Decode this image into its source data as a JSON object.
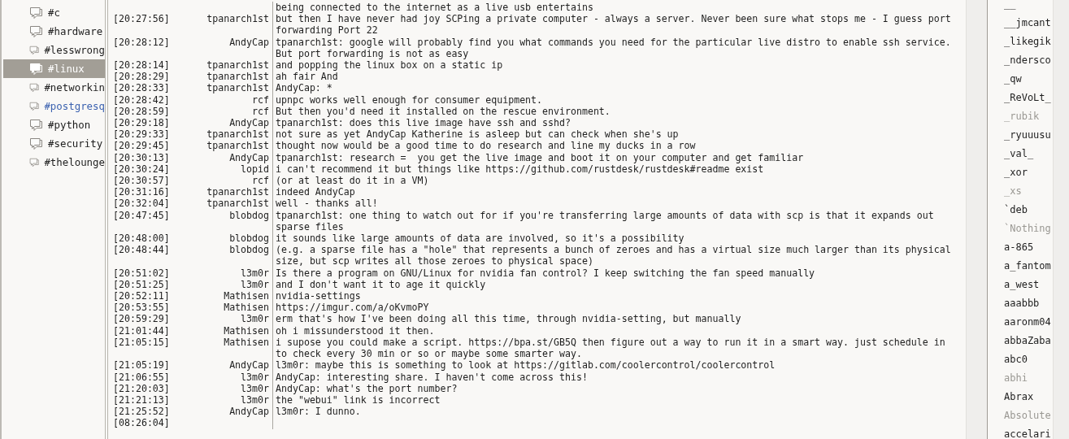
{
  "channels": [
    {
      "name": "#c",
      "selected": false,
      "highlighted": false
    },
    {
      "name": "#hardware",
      "selected": false,
      "highlighted": false
    },
    {
      "name": "#lesswrong",
      "selected": false,
      "highlighted": false
    },
    {
      "name": "#linux",
      "selected": true,
      "highlighted": false
    },
    {
      "name": "#networkin",
      "selected": false,
      "highlighted": false
    },
    {
      "name": "#postgresq",
      "selected": false,
      "highlighted": true
    },
    {
      "name": "#python",
      "selected": false,
      "highlighted": false
    },
    {
      "name": "#security",
      "selected": false,
      "highlighted": false
    },
    {
      "name": "#thelounge",
      "selected": false,
      "highlighted": false
    }
  ],
  "messages": [
    {
      "text": "being connected to the internet as a live usb entertains"
    },
    {
      "time": "[20:27:56]",
      "nick": "tpanarch1st",
      "text": "but then I have never had joy SCPing a private computer - always a server. Never been sure what stops me - I guess port forwarding Port 22"
    },
    {
      "time": "[20:28:12]",
      "nick": "AndyCap",
      "text": "tpanarch1st: google will probably find you what commands you need for the particular live distro to enable ssh service. But port forwarding is not as easy"
    },
    {
      "time": "[20:28:14]",
      "nick": "tpanarch1st",
      "text": "and popping the linux box on a static ip"
    },
    {
      "time": "[20:28:29]",
      "nick": "tpanarch1st",
      "text": "ah fair And"
    },
    {
      "time": "[20:28:33]",
      "nick": "tpanarch1st",
      "text": "AndyCap: *"
    },
    {
      "time": "[20:28:42]",
      "nick": "rcf",
      "text": "upnpc works well enough for consumer equipment."
    },
    {
      "time": "[20:28:59]",
      "nick": "rcf",
      "text": "But then you'd need it installed on the rescue environment."
    },
    {
      "time": "[20:29:18]",
      "nick": "AndyCap",
      "text": "tpanarch1st: does this live image have ssh and sshd?"
    },
    {
      "time": "[20:29:33]",
      "nick": "tpanarch1st",
      "text": "not sure as yet AndyCap Katherine is asleep but can check when she's up"
    },
    {
      "time": "[20:29:45]",
      "nick": "tpanarch1st",
      "text": "thought now would be a good time to do research and line my ducks in a row"
    },
    {
      "time": "[20:30:13]",
      "nick": "AndyCap",
      "text": "tpanarch1st: research =  you get the live image and boot it on your computer and get familiar"
    },
    {
      "time": "[20:30:24]",
      "nick": "lopid",
      "text": "i can't recommend it but things like https://github.com/rustdesk/rustdesk#readme exist"
    },
    {
      "time": "[20:30:57]",
      "nick": "rcf",
      "text": "(or at least do it in a VM)"
    },
    {
      "time": "[20:31:16]",
      "nick": "tpanarch1st",
      "text": "indeed AndyCap"
    },
    {
      "time": "[20:32:04]",
      "nick": "tpanarch1st",
      "text": "well - thanks all!"
    },
    {
      "time": "[20:47:45]",
      "nick": "blobdog",
      "text": "tpanarch1st: one thing to watch out for if you're transferring large amounts of data with scp is that it expands out sparse files"
    },
    {
      "time": "[20:48:00]",
      "nick": "blobdog",
      "text": "it sounds like large amounts of data are involved, so it's a possibility"
    },
    {
      "time": "[20:48:44]",
      "nick": "blobdog",
      "text": "(e.g. a sparse file has a \"hole\" that represents a bunch of zeroes and has a virtual size much larger than its physical size, but scp writes all those zeroes to physical space)"
    },
    {
      "time": "[20:51:02]",
      "nick": "l3m0r",
      "text": "Is there a program on GNU/Linux for nvidia fan control? I keep switching the fan speed manually"
    },
    {
      "time": "[20:51:25]",
      "nick": "l3m0r",
      "text": "and I don't want it to age it quickly"
    },
    {
      "time": "[20:52:11]",
      "nick": "Mathisen",
      "text": "nvidia-settings"
    },
    {
      "time": "[20:53:55]",
      "nick": "Mathisen",
      "text": "https://imgur.com/a/oKvmoPY"
    },
    {
      "time": "[20:59:29]",
      "nick": "l3m0r",
      "text": "erm that's how I've been doing all this time, through nvidia-setting, but manually"
    },
    {
      "time": "[21:01:44]",
      "nick": "Mathisen",
      "text": "oh i missunderstood it then."
    },
    {
      "time": "[21:05:15]",
      "nick": "Mathisen",
      "text": "i supose you could make a script. https://bpa.st/GB5Q then figure out a way to run it in a smart way. just schedule in to check every 30 min or so or maybe some smarter way."
    },
    {
      "time": "[21:05:19]",
      "nick": "AndyCap",
      "text": "l3m0r: maybe this is something to look at https://gitlab.com/coolercontrol/coolercontrol"
    },
    {
      "time": "[21:06:55]",
      "nick": "l3m0r",
      "text": "AndyCap: interesting share. I haven't come across this!"
    },
    {
      "time": "[21:20:03]",
      "nick": "l3m0r",
      "text": "AndyCap: what's the port number?"
    },
    {
      "time": "[21:21:13]",
      "nick": "l3m0r",
      "text": "the \"webui\" link is incorrect"
    },
    {
      "time": "[21:25:52]",
      "nick": "AndyCap",
      "text": "l3m0r: I dunno."
    },
    {
      "time": "[08:26:04]"
    }
  ],
  "users": [
    {
      "name": "__",
      "away": false
    },
    {
      "name": "__jmcant",
      "away": false
    },
    {
      "name": "_likegik",
      "away": false
    },
    {
      "name": "_ndersco",
      "away": false
    },
    {
      "name": "_qw",
      "away": false
    },
    {
      "name": "_ReVoLt_",
      "away": false
    },
    {
      "name": "_rubik",
      "away": true
    },
    {
      "name": "_ryuuusu",
      "away": false
    },
    {
      "name": "_val_",
      "away": false
    },
    {
      "name": "_xor",
      "away": false
    },
    {
      "name": "_xs",
      "away": true
    },
    {
      "name": "`deb",
      "away": false
    },
    {
      "name": "`Nothing",
      "away": true
    },
    {
      "name": "a-865",
      "away": false
    },
    {
      "name": "a_fantom",
      "away": false
    },
    {
      "name": "a_west",
      "away": false
    },
    {
      "name": "aaabbb",
      "away": false
    },
    {
      "name": "aaronm04",
      "away": false
    },
    {
      "name": "abbaZaba",
      "away": false
    },
    {
      "name": "abc0",
      "away": false
    },
    {
      "name": "abhi",
      "away": true
    },
    {
      "name": "Abrax",
      "away": false
    },
    {
      "name": "Absolute",
      "away": true
    },
    {
      "name": "accelari",
      "away": false
    }
  ]
}
